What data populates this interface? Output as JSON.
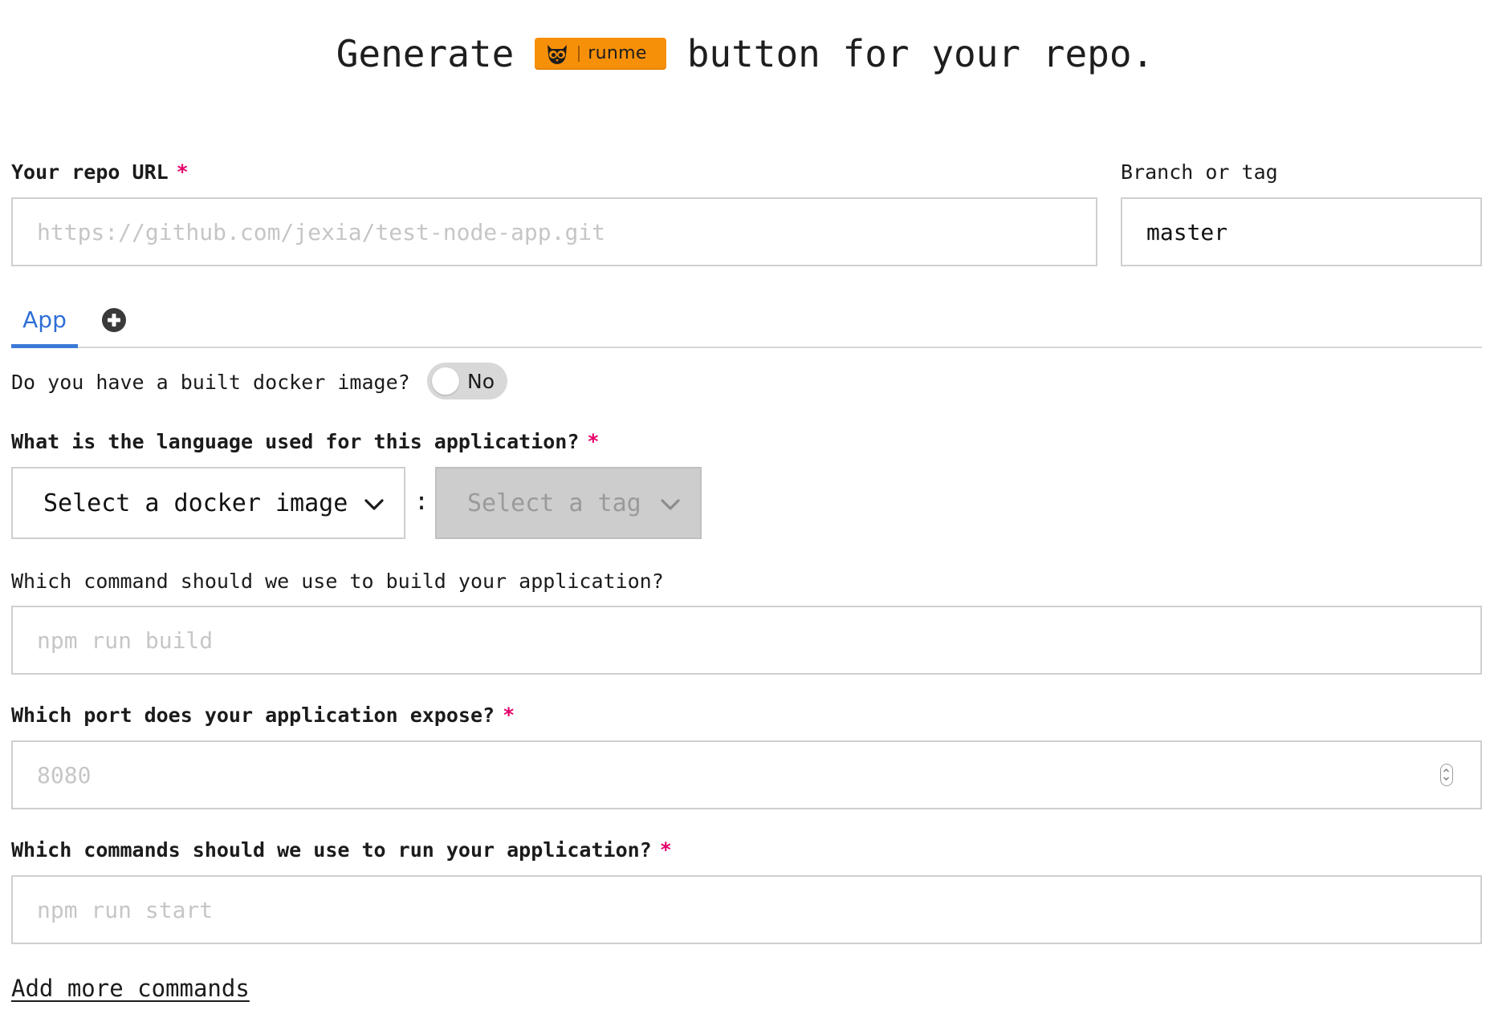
{
  "header": {
    "title_prefix": "Generate",
    "badge_text": "runme",
    "title_suffix": "button for your repo."
  },
  "form": {
    "repo_url": {
      "label": "Your repo URL",
      "required_mark": "*",
      "placeholder": "https://github.com/jexia/test-node-app.git",
      "value": ""
    },
    "branch": {
      "label": "Branch or tag",
      "value": "master"
    },
    "tabs": [
      {
        "label": "App",
        "active": true
      },
      {
        "label": "",
        "icon": "plus-circle-icon"
      }
    ],
    "docker_question": {
      "label": "Do you have a built docker image?",
      "toggle_label": "No",
      "toggle_on": false
    },
    "language": {
      "label": "What is the language used for this application?",
      "required_mark": "*",
      "image_select": "Select a docker image",
      "separator": ":",
      "tag_select": "Select a tag"
    },
    "build_command": {
      "label": "Which command should we use to build your application?",
      "placeholder": "npm run build"
    },
    "port": {
      "label": "Which port does your application expose?",
      "required_mark": "*",
      "placeholder": "8080"
    },
    "run_commands": {
      "label": "Which commands should we use to run your application?",
      "required_mark": "*",
      "placeholder": "npm run start"
    },
    "add_more_label": "Add more commands"
  },
  "colors": {
    "badge": "#f79009",
    "accent": "#3b78d8",
    "required": "#e5006a",
    "disabled_select": "#cdcdcd"
  }
}
